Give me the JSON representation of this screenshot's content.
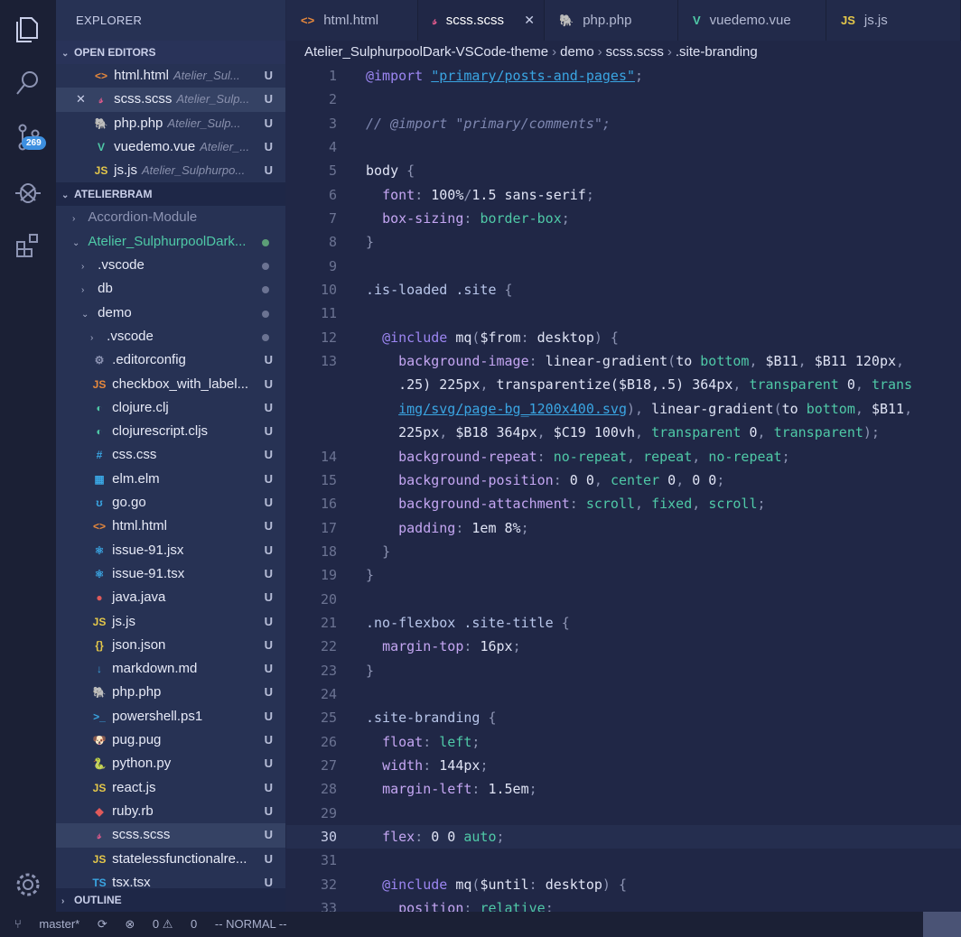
{
  "activity": {
    "scm_badge": "269"
  },
  "sidebar": {
    "title": "EXPLORER",
    "open_editors_label": "OPEN EDITORS",
    "open_editors": [
      {
        "icon": "<>",
        "color": "#e8893c",
        "name": "html.html",
        "desc": "Atelier_Sul...",
        "status": "U"
      },
      {
        "icon": "𝓈",
        "color": "#e05a8c",
        "name": "scss.scss",
        "desc": "Atelier_Sulp...",
        "status": "U",
        "selected": true,
        "close": "✕"
      },
      {
        "icon": "🐘",
        "color": "#9c86f2",
        "name": "php.php",
        "desc": "Atelier_Sulp...",
        "status": "U"
      },
      {
        "icon": "V",
        "color": "#4fc9a7",
        "name": "vuedemo.vue",
        "desc": "Atelier_...",
        "status": "U"
      },
      {
        "icon": "JS",
        "color": "#e5c84a",
        "name": "js.js",
        "desc": "Atelier_Sulphurpo...",
        "status": "U"
      }
    ],
    "workspace_label": "ATELIERBRAM",
    "tree": [
      {
        "indent": 1,
        "chev": "›",
        "name": "Accordion-Module",
        "muted": true
      },
      {
        "indent": 1,
        "chev": "⌄",
        "name": "Atelier_SulphurpoolDark...",
        "green": true,
        "dot": "green"
      },
      {
        "indent": 2,
        "chev": "›",
        "name": ".vscode",
        "dot": "grey"
      },
      {
        "indent": 2,
        "chev": "›",
        "name": "db",
        "dot": "grey"
      },
      {
        "indent": 2,
        "chev": "⌄",
        "name": "demo",
        "dot": "grey"
      },
      {
        "indent": 3,
        "chev": "›",
        "name": ".vscode",
        "dot": "grey"
      },
      {
        "indent": 3,
        "icon": "⚙",
        "color": "#8d94b3",
        "name": ".editorconfig",
        "status": "U"
      },
      {
        "indent": 3,
        "icon": "JS",
        "color": "#e8893c",
        "name": "checkbox_with_label...",
        "status": "U"
      },
      {
        "indent": 3,
        "icon": "◐",
        "color": "#4fc9a7",
        "name": "clojure.clj",
        "status": "U"
      },
      {
        "indent": 3,
        "icon": "◐",
        "color": "#4fc9a7",
        "name": "clojurescript.cljs",
        "status": "U"
      },
      {
        "indent": 3,
        "icon": "#",
        "color": "#3aa5e2",
        "name": "css.css",
        "status": "U"
      },
      {
        "indent": 3,
        "icon": "▦",
        "color": "#3aa5e2",
        "name": "elm.elm",
        "status": "U"
      },
      {
        "indent": 3,
        "icon": "ʊ",
        "color": "#3aa5e2",
        "name": "go.go",
        "status": "U"
      },
      {
        "indent": 3,
        "icon": "<>",
        "color": "#e8893c",
        "name": "html.html",
        "status": "U"
      },
      {
        "indent": 3,
        "icon": "⚛",
        "color": "#3aa5e2",
        "name": "issue-91.jsx",
        "status": "U"
      },
      {
        "indent": 3,
        "icon": "⚛",
        "color": "#3aa5e2",
        "name": "issue-91.tsx",
        "status": "U"
      },
      {
        "indent": 3,
        "icon": "●",
        "color": "#e05a5a",
        "name": "java.java",
        "status": "U"
      },
      {
        "indent": 3,
        "icon": "JS",
        "color": "#e5c84a",
        "name": "js.js",
        "status": "U"
      },
      {
        "indent": 3,
        "icon": "{}",
        "color": "#e5c84a",
        "name": "json.json",
        "status": "U"
      },
      {
        "indent": 3,
        "icon": "↓",
        "color": "#3aa5e2",
        "name": "markdown.md",
        "status": "U"
      },
      {
        "indent": 3,
        "icon": "🐘",
        "color": "#9c86f2",
        "name": "php.php",
        "status": "U"
      },
      {
        "indent": 3,
        "icon": ">_",
        "color": "#3aa5e2",
        "name": "powershell.ps1",
        "status": "U"
      },
      {
        "indent": 3,
        "icon": "🐶",
        "color": "#e05a5a",
        "name": "pug.pug",
        "status": "U"
      },
      {
        "indent": 3,
        "icon": "🐍",
        "color": "#3aa5e2",
        "name": "python.py",
        "status": "U"
      },
      {
        "indent": 3,
        "icon": "JS",
        "color": "#e5c84a",
        "name": "react.js",
        "status": "U"
      },
      {
        "indent": 3,
        "icon": "◆",
        "color": "#e05a5a",
        "name": "ruby.rb",
        "status": "U"
      },
      {
        "indent": 3,
        "icon": "𝓈",
        "color": "#e05a8c",
        "name": "scss.scss",
        "status": "U",
        "selected": true
      },
      {
        "indent": 3,
        "icon": "JS",
        "color": "#e5c84a",
        "name": "statelessfunctionalre...",
        "status": "U"
      },
      {
        "indent": 3,
        "icon": "TS",
        "color": "#3aa5e2",
        "name": "tsx.tsx",
        "status": "U"
      }
    ],
    "outline_label": "OUTLINE"
  },
  "tabs": [
    {
      "icon": "<>",
      "color": "#e8893c",
      "label": "html.html",
      "width": 146
    },
    {
      "icon": "𝓈",
      "color": "#e05a8c",
      "label": "scss.scss",
      "width": 140,
      "active": true,
      "close": "✕"
    },
    {
      "icon": "🐘",
      "color": "#9c86f2",
      "label": "php.php",
      "width": 148
    },
    {
      "icon": "V",
      "color": "#4fc9a7",
      "label": "vuedemo.vue",
      "width": 164
    },
    {
      "icon": "JS",
      "color": "#e5c84a",
      "label": "js.js",
      "width": 149
    }
  ],
  "breadcrumbs": [
    "Atelier_SulphurpoolDark-VSCode-theme",
    "demo",
    "scss.scss",
    ".site-branding"
  ],
  "editor": {
    "current_line": "30",
    "lines": [
      {
        "n": "1",
        "html": "<span class='kw'>@import</span> <span class='str'>\"primary/posts-and-pages\"</span><span class='punc'>;</span>"
      },
      {
        "n": "2",
        "html": ""
      },
      {
        "n": "3",
        "html": "<span class='cm'>// @import \"primary/comments\";</span>"
      },
      {
        "n": "4",
        "html": ""
      },
      {
        "n": "5",
        "html": "<span class='num'>body</span> <span class='punc'>{</span>"
      },
      {
        "n": "6",
        "html": "  <span class='prop'>font</span><span class='punc'>:</span> <span class='num'>100%</span><span class='punc'>/</span><span class='num'>1.5</span> <span class='num'>sans-serif</span><span class='punc'>;</span>"
      },
      {
        "n": "7",
        "html": "  <span class='prop'>box-sizing</span><span class='punc'>:</span> <span class='val'>border-box</span><span class='punc'>;</span>"
      },
      {
        "n": "8",
        "html": "<span class='punc'>}</span>"
      },
      {
        "n": "9",
        "html": ""
      },
      {
        "n": "10",
        "html": "<span class='sel2'>.is-loaded .site</span> <span class='punc'>{</span>"
      },
      {
        "n": "11",
        "html": ""
      },
      {
        "n": "12",
        "html": "  <span class='kw'>@include</span> <span class='num'>mq</span><span class='punc'>(</span><span class='num'>$from</span><span class='punc'>:</span> <span class='num'>desktop</span><span class='punc'>) {</span>"
      },
      {
        "n": "13",
        "html": "    <span class='prop'>background-image</span><span class='punc'>:</span> <span class='num'>linear-gradient</span><span class='punc'>(</span><span class='num'>to</span> <span class='val'>bottom</span><span class='punc'>,</span> <span class='num'>$B11</span><span class='punc'>,</span> <span class='num'>$B11 120px</span><span class='punc'>,</span>"
      },
      {
        "n": "",
        "html": "    <span class='num'>.25) 225px</span><span class='punc'>,</span> <span class='num'>transparentize($B18,.5) 364px</span><span class='punc'>,</span> <span class='val'>transparent</span> <span class='num'>0</span><span class='punc'>,</span> <span class='val'>trans</span>"
      },
      {
        "n": "",
        "html": "    <span class='str'>img/svg/page-bg_1200x400.svg</span><span class='punc'>),</span> <span class='num'>linear-gradient</span><span class='punc'>(</span><span class='num'>to</span> <span class='val'>bottom</span><span class='punc'>,</span> <span class='num'>$B11</span><span class='punc'>,</span>"
      },
      {
        "n": "",
        "html": "    <span class='num'>225px</span><span class='punc'>,</span> <span class='num'>$B18 364px</span><span class='punc'>,</span> <span class='num'>$C19 100vh</span><span class='punc'>,</span> <span class='val'>transparent</span> <span class='num'>0</span><span class='punc'>,</span> <span class='val'>transparent</span><span class='punc'>);</span>"
      },
      {
        "n": "14",
        "html": "    <span class='prop'>background-repeat</span><span class='punc'>:</span> <span class='val'>no-repeat</span><span class='punc'>,</span> <span class='val'>repeat</span><span class='punc'>,</span> <span class='val'>no-repeat</span><span class='punc'>;</span>"
      },
      {
        "n": "15",
        "html": "    <span class='prop'>background-position</span><span class='punc'>:</span> <span class='num'>0 0</span><span class='punc'>,</span> <span class='val'>center</span> <span class='num'>0</span><span class='punc'>,</span> <span class='num'>0 0</span><span class='punc'>;</span>"
      },
      {
        "n": "16",
        "html": "    <span class='prop'>background-attachment</span><span class='punc'>:</span> <span class='val'>scroll</span><span class='punc'>,</span> <span class='val'>fixed</span><span class='punc'>,</span> <span class='val'>scroll</span><span class='punc'>;</span>"
      },
      {
        "n": "17",
        "html": "    <span class='prop'>padding</span><span class='punc'>:</span> <span class='num'>1em 8%</span><span class='punc'>;</span>"
      },
      {
        "n": "18",
        "html": "  <span class='punc'>}</span>"
      },
      {
        "n": "19",
        "html": "<span class='punc'>}</span>"
      },
      {
        "n": "20",
        "html": ""
      },
      {
        "n": "21",
        "html": "<span class='sel2'>.no-flexbox .site-title</span> <span class='punc'>{</span>"
      },
      {
        "n": "22",
        "html": "  <span class='prop'>margin-top</span><span class='punc'>:</span> <span class='num'>16px</span><span class='punc'>;</span>"
      },
      {
        "n": "23",
        "html": "<span class='punc'>}</span>"
      },
      {
        "n": "24",
        "html": ""
      },
      {
        "n": "25",
        "html": "<span class='sel2'>.site-branding</span> <span class='punc'>{</span>"
      },
      {
        "n": "26",
        "html": "  <span class='prop'>float</span><span class='punc'>:</span> <span class='val'>left</span><span class='punc'>;</span>"
      },
      {
        "n": "27",
        "html": "  <span class='prop'>width</span><span class='punc'>:</span> <span class='num'>144px</span><span class='punc'>;</span>"
      },
      {
        "n": "28",
        "html": "  <span class='prop'>margin-left</span><span class='punc'>:</span> <span class='num'>1.5em</span><span class='punc'>;</span>"
      },
      {
        "n": "29",
        "html": ""
      },
      {
        "n": "30",
        "html": "  <span class='prop'>flex</span><span class='punc'>:</span> <span class='num'>0 0</span> <span class='val'>auto</span><span class='punc'>;</span>"
      },
      {
        "n": "31",
        "html": ""
      },
      {
        "n": "32",
        "html": "  <span class='kw'>@include</span> <span class='num'>mq</span><span class='punc'>(</span><span class='num'>$until</span><span class='punc'>:</span> <span class='num'>desktop</span><span class='punc'>) {</span>"
      },
      {
        "n": "33",
        "html": "    <span class='prop'>position</span><span class='punc'>:</span> <span class='val'>relative</span><span class='punc'>;</span>"
      }
    ]
  },
  "status": {
    "branch": "master*",
    "errors": "0",
    "warnings": "0",
    "mode": "-- NORMAL --"
  }
}
